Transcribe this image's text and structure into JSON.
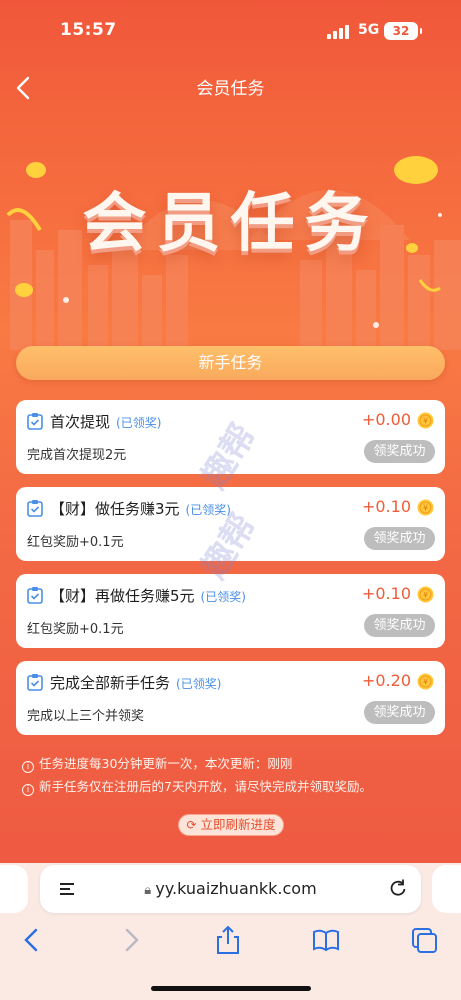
{
  "status_bar": {
    "time": "15:57",
    "network": "5G",
    "battery": "32"
  },
  "nav": {
    "title": "会员任务"
  },
  "hero": {
    "title": "会员任务"
  },
  "section": {
    "button_label": "新手任务"
  },
  "tasks": [
    {
      "title": "首次提现",
      "tag": "(已领奖)",
      "amount": "+0.00",
      "desc": "完成首次提现2元",
      "status": "领奖成功"
    },
    {
      "title": "【财】做任务赚3元",
      "tag": "(已领奖)",
      "amount": "+0.10",
      "desc": "红包奖励+0.1元",
      "status": "领奖成功"
    },
    {
      "title": "【财】再做任务赚5元",
      "tag": "(已领奖)",
      "amount": "+0.10",
      "desc": "红包奖励+0.1元",
      "status": "领奖成功"
    },
    {
      "title": "完成全部新手任务",
      "tag": "(已领奖)",
      "amount": "+0.20",
      "desc": "完成以上三个并领奖",
      "status": "领奖成功"
    }
  ],
  "notes": [
    "任务进度每30分钟更新一次，本次更新：刚刚",
    "新手任务仅在注册后的7天内开放，请尽快完成并领取奖励。"
  ],
  "refresh": {
    "label": "立即刷新进度"
  },
  "watermark": {
    "text1": "趣帮",
    "text2": "趣帮"
  },
  "browser": {
    "url": "yy.kuaizhuankk.com"
  },
  "icons": {
    "back": "chevron-left-icon",
    "check": "clipboard-check-icon",
    "coin": "yuan-coin-icon",
    "lock": "lock-icon",
    "reload": "reload-icon",
    "share": "share-icon",
    "bookmarks": "book-icon",
    "tabs": "tabs-icon"
  },
  "colors": {
    "primary": "#f0573a",
    "button": "#f9a95d",
    "amount": "#ef5c36",
    "tag": "#4a8fe8",
    "done": "#bdbdbd"
  }
}
